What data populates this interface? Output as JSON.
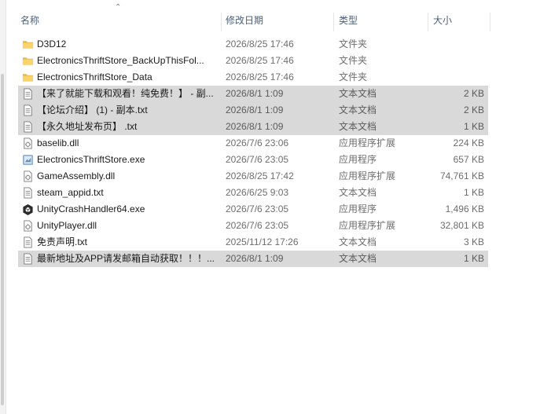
{
  "columns": {
    "name": "名称",
    "date": "修改日期",
    "type": "类型",
    "size": "大小"
  },
  "files": [
    {
      "icon": "folder-icon",
      "name": "D3D12",
      "date": "2026/8/25 17:46",
      "type": "文件夹",
      "size": "",
      "selected": false
    },
    {
      "icon": "folder-icon",
      "name": "ElectronicsThriftStore_BackUpThisFol...",
      "date": "2026/8/25 17:46",
      "type": "文件夹",
      "size": "",
      "selected": false
    },
    {
      "icon": "folder-icon",
      "name": "ElectronicsThriftStore_Data",
      "date": "2026/8/25 17:46",
      "type": "文件夹",
      "size": "",
      "selected": false
    },
    {
      "icon": "text-file-icon",
      "name": "【来了就能下载和观看！纯免费！】 - 副...",
      "date": "2026/8/1 1:09",
      "type": "文本文档",
      "size": "2 KB",
      "selected": true
    },
    {
      "icon": "text-file-icon",
      "name": "【论坛介绍】 (1) - 副本.txt",
      "date": "2026/8/1 1:09",
      "type": "文本文档",
      "size": "2 KB",
      "selected": true
    },
    {
      "icon": "text-file-icon",
      "name": "【永久地址发布页】 .txt",
      "date": "2026/8/1 1:09",
      "type": "文本文档",
      "size": "1 KB",
      "selected": true
    },
    {
      "icon": "dll-file-icon",
      "name": "baselib.dll",
      "date": "2026/7/6 23:06",
      "type": "应用程序扩展",
      "size": "224 KB",
      "selected": false
    },
    {
      "icon": "game-exe-icon",
      "name": "ElectronicsThriftStore.exe",
      "date": "2026/7/6 23:05",
      "type": "应用程序",
      "size": "657 KB",
      "selected": false
    },
    {
      "icon": "dll-file-icon",
      "name": "GameAssembly.dll",
      "date": "2026/8/25 17:42",
      "type": "应用程序扩展",
      "size": "74,761 KB",
      "selected": false
    },
    {
      "icon": "text-file-icon",
      "name": "steam_appid.txt",
      "date": "2026/6/25 9:03",
      "type": "文本文档",
      "size": "1 KB",
      "selected": false
    },
    {
      "icon": "unity-exe-icon",
      "name": "UnityCrashHandler64.exe",
      "date": "2026/7/6 23:05",
      "type": "应用程序",
      "size": "1,496 KB",
      "selected": false
    },
    {
      "icon": "dll-file-icon",
      "name": "UnityPlayer.dll",
      "date": "2026/7/6 23:05",
      "type": "应用程序扩展",
      "size": "32,801 KB",
      "selected": false
    },
    {
      "icon": "text-file-icon",
      "name": "免责声明.txt",
      "date": "2025/11/12 17:26",
      "type": "文本文档",
      "size": "3 KB",
      "selected": false
    },
    {
      "icon": "text-file-icon",
      "name": "最新地址及APP请发邮箱自动获取！！！...",
      "date": "2026/8/1 1:09",
      "type": "文本文档",
      "size": "1 KB",
      "selected": true
    }
  ]
}
